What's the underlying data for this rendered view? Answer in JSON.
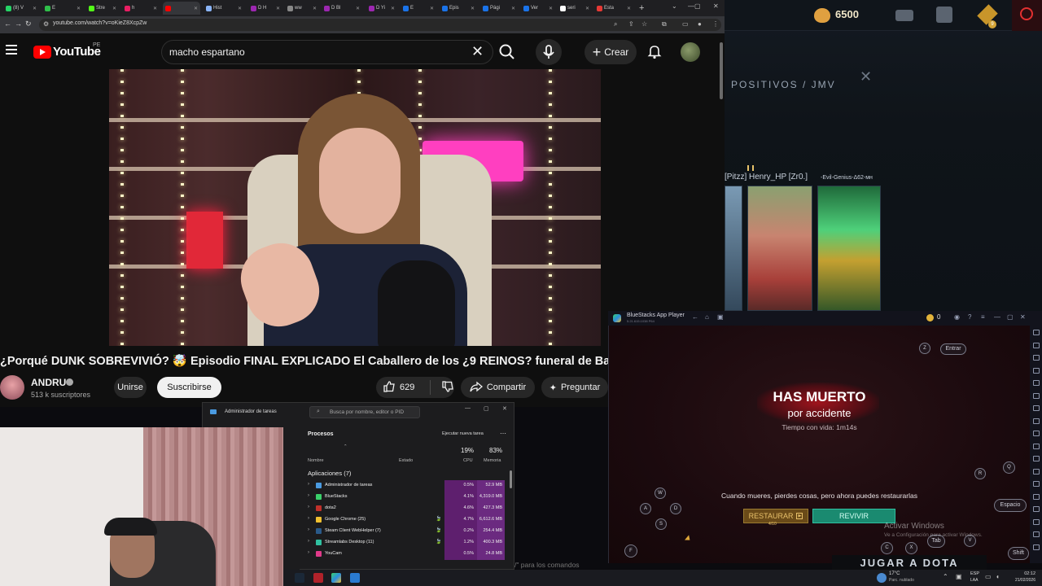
{
  "chrome": {
    "tabs": [
      {
        "label": "(8) V",
        "fav": "#25d366"
      },
      {
        "label": "E",
        "fav": "#2fbf4a"
      },
      {
        "label": "Stre",
        "fav": "#53fc18"
      },
      {
        "label": "h",
        "fav": "#e91e63"
      },
      {
        "label": "",
        "fav": "#ff0000"
      },
      {
        "label": "Hist",
        "fav": "#8ab4f8"
      },
      {
        "label": "D H",
        "fav": "#9c27b0"
      },
      {
        "label": "ww",
        "fav": "#888888"
      },
      {
        "label": "D Bl",
        "fav": "#9c27b0"
      },
      {
        "label": "D Yi",
        "fav": "#9c27b0"
      },
      {
        "label": "E",
        "fav": "#1a73e8"
      },
      {
        "label": "Epis",
        "fav": "#1a73e8"
      },
      {
        "label": "Pági",
        "fav": "#1a73e8"
      },
      {
        "label": "Ver",
        "fav": "#1a73e8"
      },
      {
        "label": "seri",
        "fav": "#ffffff"
      },
      {
        "label": "Esta",
        "fav": "#e53935"
      }
    ],
    "new_tab": "+",
    "url": "youtube.com/watch?v=oKieZ8XcpZw"
  },
  "youtube": {
    "logo_text": "YouTube",
    "region": "PE",
    "search_value": "macho espartano",
    "create_label": "Crear",
    "video_title": "¿Porqué DUNK SOBREVIVIÓ? 🤯 Episodio FINAL EXPLICADO El Caballero de los ¿9 REINOS? funeral de Baelor",
    "channel_name": "ANDRU",
    "subscribers": "513 k suscriptores",
    "join_label": "Unirse",
    "subscribe_label": "Suscribirse",
    "likes": "629",
    "share_label": "Compartir",
    "ask_label": "Preguntar"
  },
  "game": {
    "gold": "6500",
    "badge_count": "9",
    "breadcrumb": "POSITIVOS  /  JMV",
    "heroes": [
      {
        "name": "[Pitzz]"
      },
      {
        "name": "Henry_HP [Zr0.]"
      },
      {
        "name": "-Evil-Genius-Δ62-мн"
      }
    ],
    "play_label": "JUGAR A DOTA"
  },
  "bluestacks": {
    "app_name": "BlueStacks App Player",
    "version": "5.21.615.1038 P64",
    "coins": "0",
    "dead_title": "HAS MUERTO",
    "dead_subtitle": "por accidente",
    "time_alive": "Tiempo con vida: 1m14s",
    "message": "Cuando mueres, pierdes cosas, pero ahora puedes restaurarlas",
    "restore_label": "RESTAURAR",
    "restore_cost": "4/10",
    "revive_label": "REVIVIR",
    "keys": {
      "z": "Z",
      "enter": "Entrar",
      "q": "Q",
      "r": "R",
      "w": "W",
      "a": "A",
      "d": "D",
      "s": "S",
      "space": "Espacio",
      "f": "F",
      "c": "C",
      "x": "X",
      "tab": "Tab",
      "v": "V",
      "shift": "Shift"
    },
    "activate_title": "Activar Windows",
    "activate_sub": "Ve a Configuración para activar Windows."
  },
  "taskmanager": {
    "title": "Administrador de tareas",
    "search_placeholder": "Busca por nombre, editor o PID",
    "section": "Procesos",
    "new_task": "Ejecutar nueva tarea",
    "col_name": "Nombre",
    "col_status": "Estado",
    "col_cpu": "CPU",
    "col_mem": "Memoria",
    "cpu_total": "19%",
    "mem_total": "83%",
    "apps_header": "Aplicaciones (7)",
    "rows": [
      {
        "name": "Administrador de tareas",
        "cpu": "0.5%",
        "mem": "52.9 MB",
        "color": "#4a9ae0",
        "leaf": ""
      },
      {
        "name": "BlueStacks",
        "cpu": "4.1%",
        "mem": "4,319.0 MB",
        "color": "#3ad06a",
        "leaf": ""
      },
      {
        "name": "dota2",
        "cpu": "4.6%",
        "mem": "427.3 MB",
        "color": "#c0302a",
        "leaf": ""
      },
      {
        "name": "Google Chrome (25)",
        "cpu": "4.7%",
        "mem": "6,612.6 MB",
        "color": "#f0c030",
        "leaf": "🍃"
      },
      {
        "name": "Steam Client WebHelper (7)",
        "cpu": "0.2%",
        "mem": "254.4 MB",
        "color": "#2a5a8a",
        "leaf": "🍃"
      },
      {
        "name": "Streamlabs Desktop (11)",
        "cpu": "1.2%",
        "mem": "400.3 MB",
        "color": "#30c0a0",
        "leaf": "🍃"
      },
      {
        "name": "YouCam",
        "cpu": "0.5%",
        "mem": "24.8 MB",
        "color": "#e03a8a",
        "leaf": ""
      }
    ],
    "cmd_hint": "/\" para los comandos"
  },
  "taskbar": {
    "weather_temp": "17°C",
    "weather_desc": "Parc. nublado",
    "lang1": "ESP",
    "lang2": "LAA",
    "time": "02:12",
    "date": "21/02/2026"
  }
}
